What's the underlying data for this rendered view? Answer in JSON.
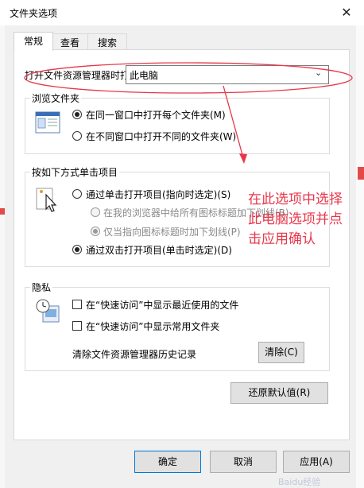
{
  "dialog": {
    "title": "文件夹选项",
    "close_glyph": "✕"
  },
  "tabs": [
    {
      "label": "常规"
    },
    {
      "label": "查看"
    },
    {
      "label": "搜索"
    }
  ],
  "open_explorer": {
    "label": "打开文件资源管理器时打",
    "value": "此电脑"
  },
  "browse": {
    "legend": "浏览文件夹",
    "option1": "在同一窗口中打开每个文件夹(M)",
    "option2": "在不同窗口中打开不同的文件夹(W)"
  },
  "click": {
    "legend": "按如下方式单击项目",
    "single": "通过单击打开项目(指向时选定)(S)",
    "underline_all": "在我的浏览器中给所有图标标题加下划线(B)",
    "underline_point": "仅当指向图标标题时加下划线(P)",
    "double": "通过双击打开项目(单击时选定)(D)"
  },
  "privacy": {
    "legend": "隐私",
    "recent_files": "在“快速访问”中显示最近使用的文件",
    "frequent_folders": "在“快速访问”中显示常用文件夹",
    "clear_label": "清除文件资源管理器历史记录",
    "clear_button": "清除(C)"
  },
  "restore_button": "还原默认值(R)",
  "footer": {
    "ok": "确定",
    "cancel": "取消",
    "apply": "应用(A)"
  },
  "annotation": {
    "line1": "在此选项中选择",
    "line2": "此电脑选项并点",
    "line3": "击应用确认"
  },
  "watermark": "Baidu经验",
  "colors": {
    "annotation": "#e8374b",
    "default_button_border": "#0078d7"
  }
}
